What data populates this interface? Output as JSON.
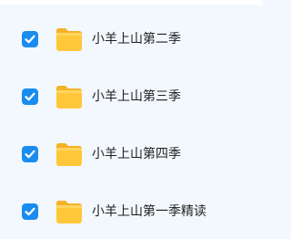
{
  "accent_color": "#1a8cf0",
  "folder_color": "#ffc73a",
  "items": [
    {
      "label": "小羊上山第二季",
      "checked": true,
      "icon": "folder-icon"
    },
    {
      "label": "小羊上山第三季",
      "checked": true,
      "icon": "folder-icon"
    },
    {
      "label": "小羊上山第四季",
      "checked": true,
      "icon": "folder-icon"
    },
    {
      "label": "小羊上山第一季精读",
      "checked": true,
      "icon": "folder-icon"
    }
  ]
}
